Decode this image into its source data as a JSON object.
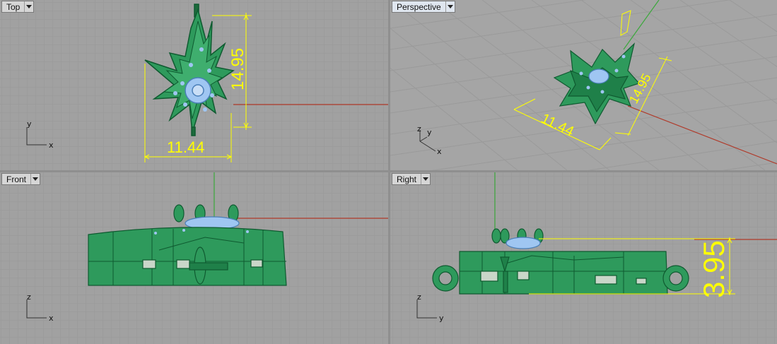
{
  "viewports": [
    {
      "label": "Top",
      "axes": [
        "x",
        "y"
      ],
      "dimensions": [
        "14.95",
        "11.44"
      ]
    },
    {
      "label": "Perspective",
      "axes": [
        "x",
        "y",
        "z"
      ],
      "dimensions": [
        "14.95",
        "11.44"
      ]
    },
    {
      "label": "Front",
      "axes": [
        "x",
        "z"
      ],
      "dimensions": []
    },
    {
      "label": "Right",
      "axes": [
        "y",
        "z"
      ],
      "dimensions": [
        "3.95"
      ]
    }
  ],
  "colors": {
    "model_green": "#2e9a5c",
    "model_dark": "#0f5a30",
    "highlight_blue": "#9fc6f2",
    "dimension_yellow": "#ffff00",
    "x_axis_red": "#b03a2a",
    "z_axis_green": "#3ca83c",
    "viewport_bg": "#a1a1a1",
    "grid_line": "#979797"
  }
}
